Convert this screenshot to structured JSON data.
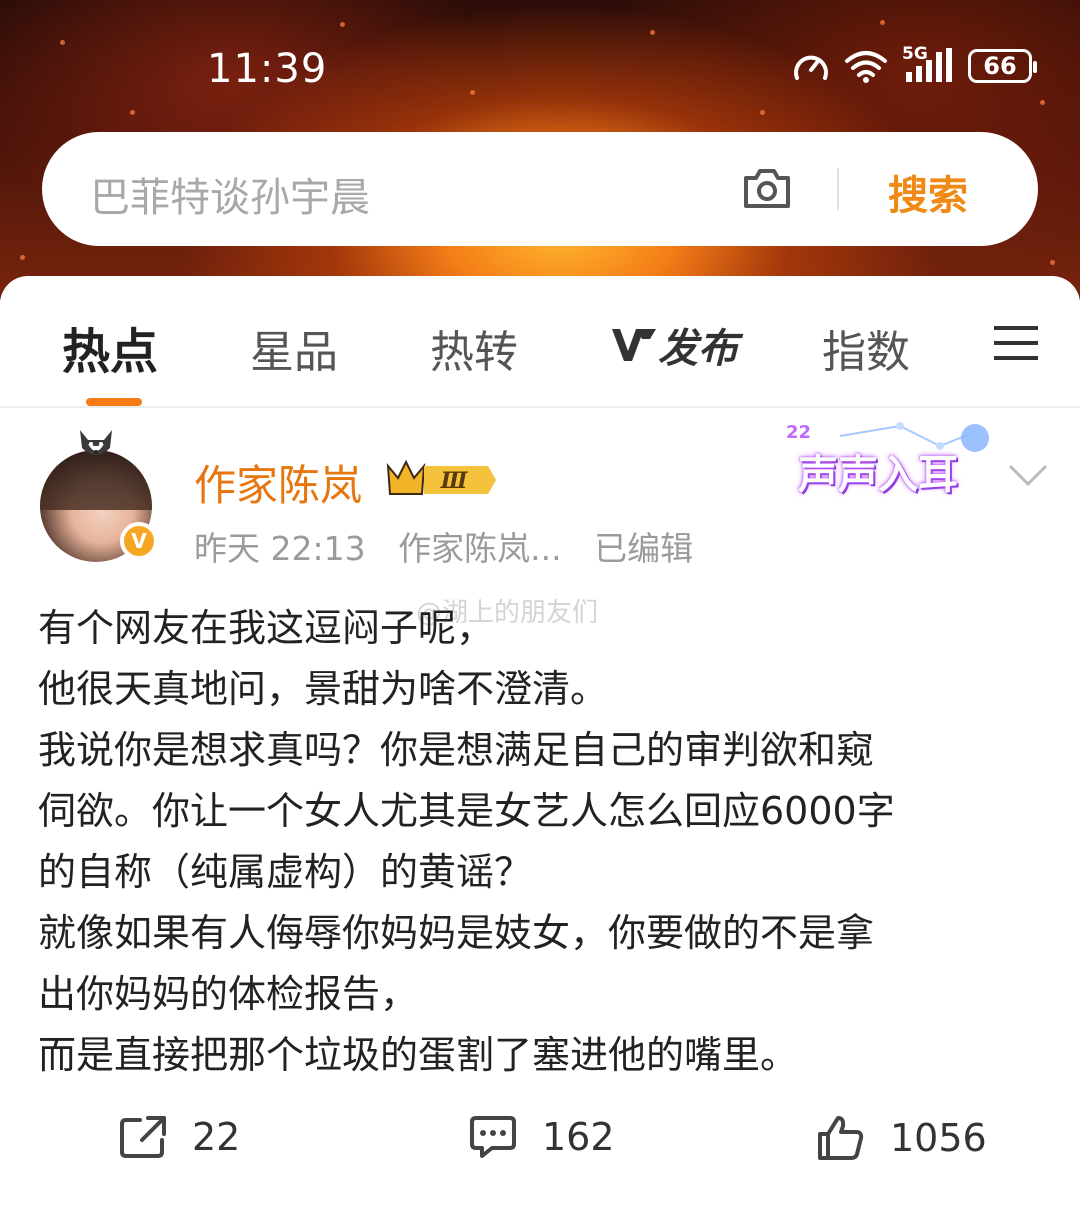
{
  "status_bar": {
    "time": "11:39",
    "network": "5G",
    "battery": "66"
  },
  "search": {
    "placeholder": "巴菲特谈孙宇晨",
    "button_label": "搜索",
    "camera_icon": "camera-icon",
    "accent_color": "#f08a17"
  },
  "tabs": [
    {
      "label": "热点",
      "active": true
    },
    {
      "label": "星品",
      "active": false
    },
    {
      "label": "热转",
      "active": false
    },
    {
      "label": "发布",
      "active": false
    },
    {
      "label": "指数",
      "active": false
    }
  ],
  "post": {
    "author": "作家陈岚",
    "member_level": "Ⅲ",
    "verified_badge": "V",
    "time": "昨天 22:13",
    "source": "作家陈岚...",
    "edited": "已编辑",
    "sticker": "声声入耳",
    "sticker_number": "22",
    "watermark": "@湖上的朋友们",
    "body_lines": [
      "有个网友在我这逗闷子呢，",
      "他很天真地问，景甜为啥不澄清。",
      "我说你是想求真吗？你是想满足自己的审判欲和窥",
      "伺欲。你让一个女人尤其是女艺人怎么回应6000字",
      "的自称（纯属虚构）的黄谣？",
      "就像如果有人侮辱你妈妈是妓女，你要做的不是拿",
      "出你妈妈的体检报告，",
      "而是直接把那个垃圾的蛋割了塞进他的嘴里。"
    ],
    "repost_count": "22",
    "comment_count": "162",
    "like_count": "1056"
  }
}
